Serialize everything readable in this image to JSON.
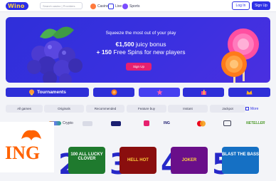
{
  "brand": {
    "logo_text": "Wino",
    "accent": "#2f31e6",
    "hero_bg": "#2f2fd9",
    "pink": "#e6206f"
  },
  "header": {
    "search_placeholder": "Search casino | Providers",
    "nav": [
      {
        "label": "Casino",
        "icon": "casino-icon"
      },
      {
        "label": "Live",
        "icon": "live-icon"
      },
      {
        "label": "Sports",
        "icon": "sports-icon"
      }
    ],
    "login_label": "Log In",
    "signup_label": "Sign Up"
  },
  "hero": {
    "title": "Squeeze the most out of your play",
    "bonus_amount": "€1,500",
    "bonus_text": "juicy bonus",
    "spins_prefix": "+ 150",
    "spins_text": "Free Spins for new players",
    "cta_label": "Sign Up"
  },
  "categories": [
    {
      "label": "Tournaments",
      "icon": "trophy-icon"
    },
    {
      "label": "",
      "icon": "coin-icon"
    },
    {
      "label": "",
      "icon": "star-icon"
    },
    {
      "label": "",
      "icon": "gift-icon"
    },
    {
      "label": "",
      "icon": "crown-icon"
    }
  ],
  "filters": [
    "All games",
    "Originals",
    "Recommended",
    "Feature buy",
    "Instant",
    "Jackpot"
  ],
  "more_label": "More",
  "payments": [
    "Crypto",
    "",
    "",
    "",
    "ING",
    "",
    "",
    "NETELLER"
  ],
  "ing_logo": "ING",
  "games": [
    {
      "rank": "2",
      "title": "100 ALL LUCKY CLOVER",
      "bg": "#1f7a2e"
    },
    {
      "rank": "3",
      "title": "HELL HOT",
      "bg": "#8a0e0e"
    },
    {
      "rank": "4",
      "title": "JOKER",
      "bg": "#6a0f8a"
    },
    {
      "rank": "5",
      "title": "BLAST THE BASS",
      "bg": "#1570c4"
    }
  ]
}
